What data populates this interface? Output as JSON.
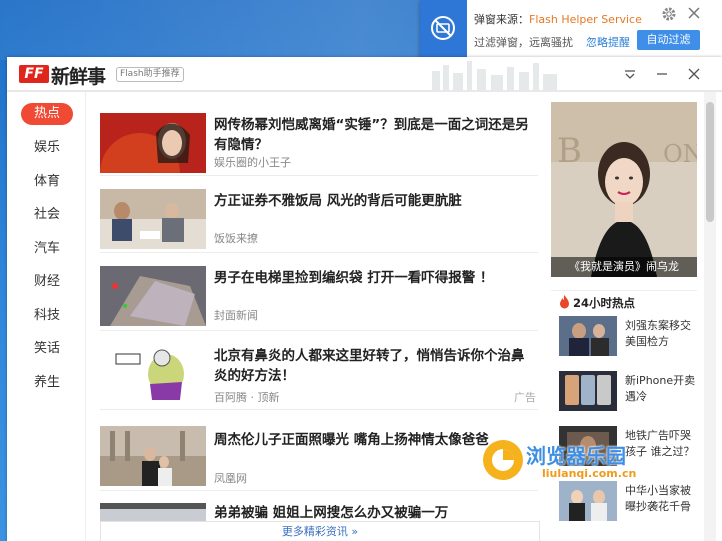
{
  "toast": {
    "title_prefix": "弹窗来源：",
    "source": "Flash Helper Service",
    "subtitle": "过滤弹窗，远离骚扰",
    "ignore_label": "忽略提醒",
    "auto_filter_label": "自动过滤",
    "icon": "block-icon"
  },
  "window": {
    "logo_mark": "FF",
    "logo_text": "新鲜事",
    "logo_tag": "Flash助手推荐",
    "accent_color": "#e0251b"
  },
  "sidebar": {
    "items": [
      {
        "label": "热点",
        "active": true
      },
      {
        "label": "娱乐"
      },
      {
        "label": "体育"
      },
      {
        "label": "社会"
      },
      {
        "label": "汽车"
      },
      {
        "label": "财经"
      },
      {
        "label": "科技"
      },
      {
        "label": "笑话"
      },
      {
        "label": "养生"
      }
    ]
  },
  "feed": {
    "items": [
      {
        "title": "网传杨幂刘恺威离婚“实锤”？到底是一面之词还是另有隐情？",
        "source": "娱乐圈的小王子"
      },
      {
        "title": "方正证券不雅饭局 风光的背后可能更肮脏",
        "source": "饭饭来撩"
      },
      {
        "title": "男子在电梯里捡到编织袋 打开一看吓得报警 ！",
        "source": "封面新闻"
      },
      {
        "title": "北京有鼻炎的人都来这里好转了，悄悄告诉你个治鼻炎的好方法！",
        "source": "百阿腾 · 顶新",
        "ad": "广告"
      },
      {
        "title": "周杰伦儿子正面照曝光 嘴角上扬神情太像爸爸",
        "source": "凤凰网"
      },
      {
        "title": "弟弟被骗 姐姐上网搜怎么办又被骗一万",
        "source": ""
      }
    ],
    "more_label": "更多精彩资讯 »"
  },
  "right": {
    "feature_caption": "《我就是演员》闹乌龙",
    "hot_title": "24小时热点",
    "hot_items": [
      {
        "text": "刘强东案移交美国检方"
      },
      {
        "text": "新iPhone开卖遇冷"
      },
      {
        "text": "地铁广告吓哭孩子 谁之过？"
      },
      {
        "text": "中华小当家被曝抄袭花千骨"
      }
    ]
  },
  "watermark": {
    "title": "浏览器乐园",
    "url": "liulanqi.com.cn"
  }
}
